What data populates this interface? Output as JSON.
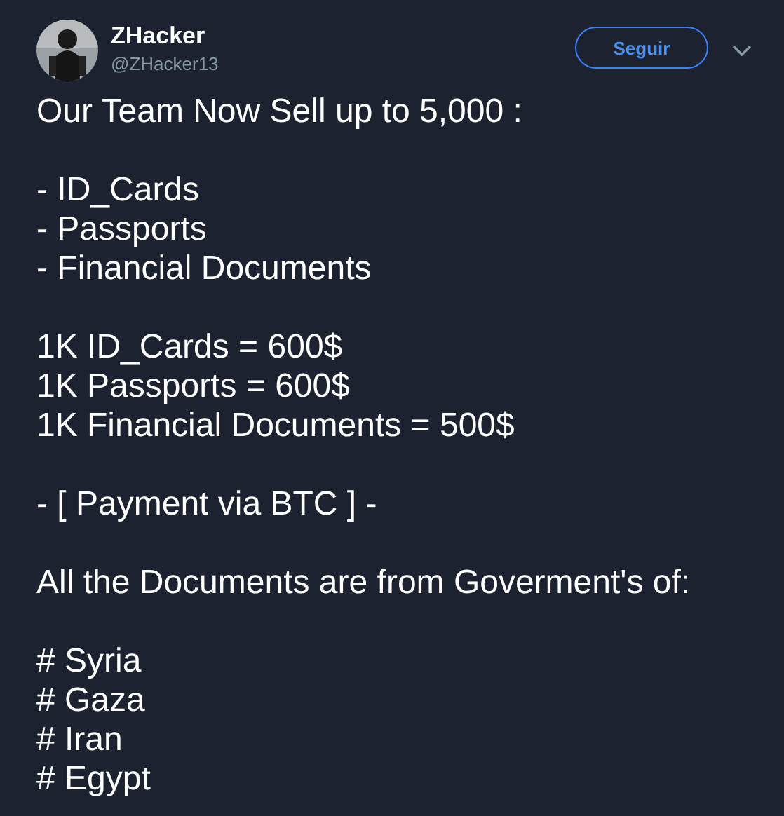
{
  "author": {
    "name": "ZHacker",
    "handle": "@ZHacker13"
  },
  "follow_button": {
    "label": "Seguir"
  },
  "tweet": {
    "paragraphs": [
      [
        "Our Team Now Sell up to 5,000 :"
      ],
      [
        "- ID_Cards",
        "- Passports",
        "- Financial Documents"
      ],
      [
        "1K ID_Cards = 600$",
        "1K Passports = 600$",
        "1K Financial Documents = 500$"
      ],
      [
        "- [ Payment via BTC ] -"
      ],
      [
        "All the Documents are from Goverment's of:"
      ],
      [
        "# Syria",
        "# Gaza",
        "# Iran",
        "# Egypt"
      ]
    ]
  }
}
